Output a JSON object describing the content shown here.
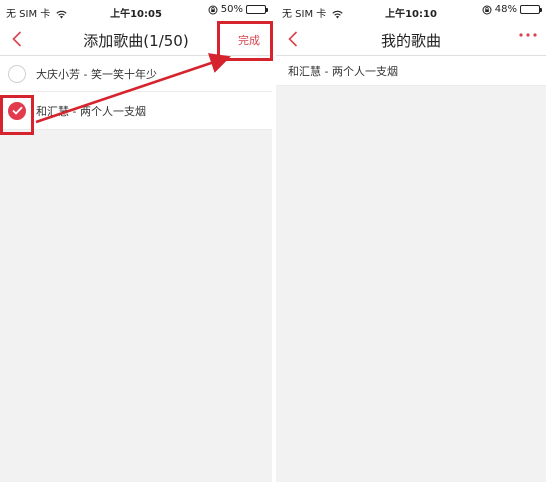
{
  "left_screen": {
    "status": {
      "carrier": "无 SIM 卡",
      "time": "上午10:05",
      "battery": "50%",
      "battery_level": 0.5
    },
    "nav": {
      "title": "添加歌曲(1/50)",
      "done_label": "完成"
    },
    "songs": [
      {
        "text": "大庆小芳 - 笑一笑十年少",
        "checked": false
      },
      {
        "text": "和汇慧 - 两个人一支烟",
        "checked": true
      }
    ]
  },
  "right_screen": {
    "status": {
      "carrier": "无 SIM 卡",
      "time": "上午10:10",
      "battery": "48%",
      "battery_level": 0.48
    },
    "nav": {
      "title": "我的歌曲"
    },
    "songs": [
      {
        "text": "和汇慧 - 两个人一支烟"
      }
    ]
  },
  "colors": {
    "accent": "#e43a4d",
    "annotation": "#d6242f"
  },
  "icons": {
    "back": "chevron-left-icon",
    "check": "checkmark-icon",
    "more": "more-dots-icon",
    "wifi": "wifi-icon",
    "battery": "battery-icon",
    "rotation_lock": "rotation-lock-icon"
  }
}
